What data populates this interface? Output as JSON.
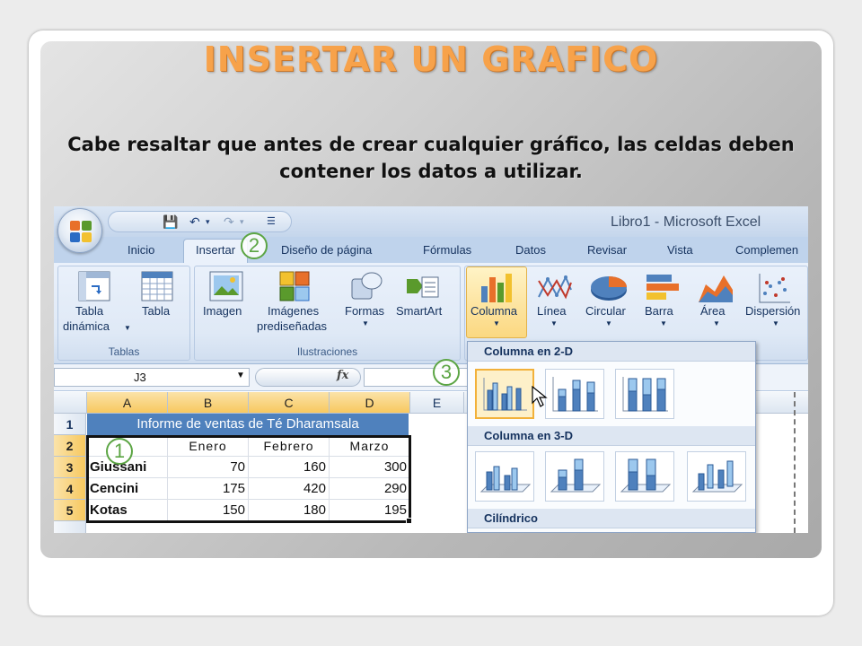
{
  "slide": {
    "title": "INSERTAR UN GRAFICO",
    "subtitle": "Cabe resaltar que antes de crear cualquier gráfico, las celdas deben contener los datos a utilizar."
  },
  "excel": {
    "window_title": "Libro1 - Microsoft Excel",
    "tabs": [
      "Inicio",
      "Insertar",
      "Diseño de página",
      "Fórmulas",
      "Datos",
      "Revisar",
      "Vista",
      "Complemen"
    ],
    "active_tab": "Insertar",
    "ribbon": {
      "groups": [
        {
          "label": "Tablas",
          "buttons": [
            {
              "label": "Tabla",
              "label2": "dinámica",
              "icon": "pivot-table-icon"
            },
            {
              "label": "Tabla",
              "label2": "",
              "icon": "table-icon"
            }
          ]
        },
        {
          "label": "Ilustraciones",
          "buttons": [
            {
              "label": "Imagen",
              "label2": "",
              "icon": "picture-icon"
            },
            {
              "label": "Imágenes",
              "label2": "prediseñadas",
              "icon": "clipart-icon"
            },
            {
              "label": "Formas",
              "label2": "",
              "icon": "shapes-icon"
            },
            {
              "label": "SmartArt",
              "label2": "",
              "icon": "smartart-icon"
            }
          ]
        },
        {
          "label": "",
          "buttons": [
            {
              "label": "Columna",
              "icon": "column-chart-icon"
            },
            {
              "label": "Línea",
              "icon": "line-chart-icon"
            },
            {
              "label": "Circular",
              "icon": "pie-chart-icon"
            },
            {
              "label": "Barra",
              "icon": "bar-chart-icon"
            },
            {
              "label": "Área",
              "icon": "area-chart-icon"
            },
            {
              "label": "Dispersión",
              "icon": "scatter-chart-icon"
            }
          ]
        }
      ]
    },
    "formula_bar": {
      "name_box": "J3",
      "fx": "fx",
      "value": ""
    },
    "columns": [
      "A",
      "B",
      "C",
      "D",
      "E"
    ],
    "rows": [
      "1",
      "2",
      "3",
      "4",
      "5"
    ],
    "sheet": {
      "title": "Informe de ventas de Té Dharamsala",
      "headers": [
        "Enero",
        "Febrero",
        "Marzo"
      ],
      "data": [
        {
          "name": "Giussani",
          "values": [
            "70",
            "160",
            "300"
          ]
        },
        {
          "name": "Cencini",
          "values": [
            "175",
            "420",
            "290"
          ]
        },
        {
          "name": "Kotas",
          "values": [
            "150",
            "180",
            "195"
          ]
        }
      ]
    },
    "gallery": {
      "sections": [
        "Columna en 2-D",
        "Columna en 3-D",
        "Cilíndrico"
      ]
    },
    "callouts": [
      "1",
      "2",
      "3"
    ],
    "accent": "#4f81bd",
    "callout_color": "#5ca544"
  }
}
